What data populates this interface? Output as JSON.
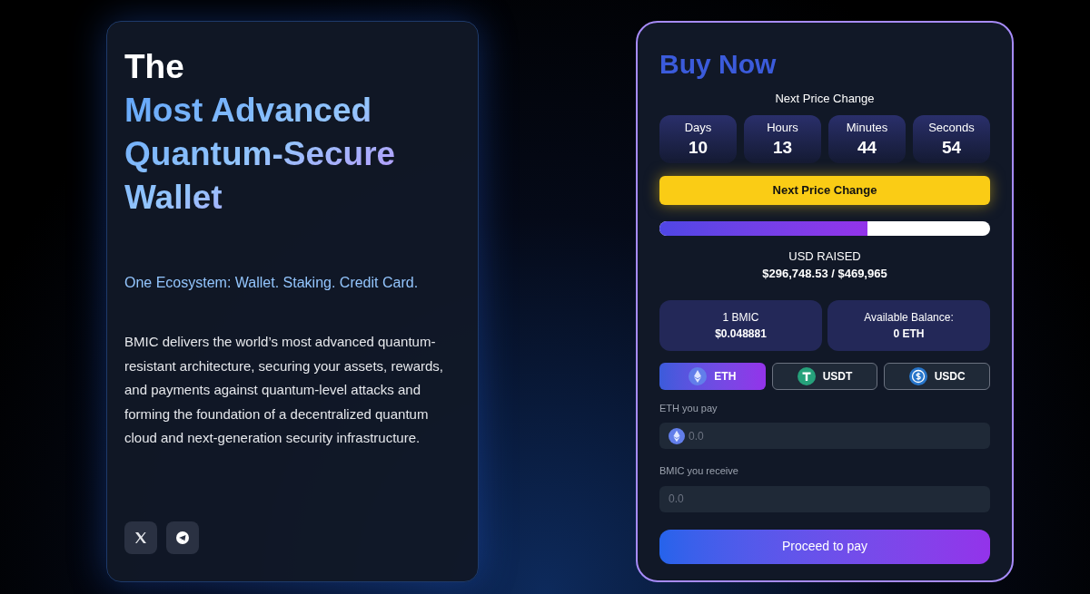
{
  "hero": {
    "title_lines": [
      {
        "text": "The",
        "kind": "plain"
      },
      {
        "text": "Most Advanced",
        "kind": "gradient"
      },
      {
        "text": "Quantum-Secure",
        "kind": "gradient"
      },
      {
        "text": "Wallet",
        "kind": "gradient"
      }
    ],
    "tagline": "One Ecosystem: Wallet. Staking. Credit Card.",
    "description": "BMIC delivers the world’s most advanced quantum-resistant architecture, securing your assets, rewards, and payments against quantum-level attacks and forming the foundation of a decentralized quantum cloud and next-generation security infrastructure.",
    "socials": [
      {
        "kind": "x"
      },
      {
        "kind": "telegram"
      }
    ]
  },
  "buy": {
    "title": "Buy Now",
    "countdown_label": "Next Price Change",
    "countdown": [
      {
        "label": "Days",
        "value": "10"
      },
      {
        "label": "Hours",
        "value": "13"
      },
      {
        "label": "Minutes",
        "value": "44"
      },
      {
        "label": "Seconds",
        "value": "54"
      }
    ],
    "price_button": "Next Price Change",
    "progress": {
      "level": 0.63
    },
    "raised_label": "USD RAISED",
    "raised_value": "$296,748.53 / $469,965",
    "stats": [
      {
        "label": "1 BMIC",
        "value": "$0.048881"
      },
      {
        "label": "Available Balance:",
        "value": "0 ETH"
      }
    ],
    "tokens": [
      {
        "label": "ETH",
        "kind": "eth",
        "selected": true
      },
      {
        "label": "USDT",
        "kind": "usdt",
        "selected": false
      },
      {
        "label": "USDC",
        "kind": "usdc",
        "selected": false
      }
    ],
    "fields": [
      {
        "label": "ETH you pay",
        "placeholder": "0.0",
        "kind": "eth"
      },
      {
        "label": "BMIC you receive",
        "placeholder": "0.0",
        "kind": "plain"
      }
    ],
    "submit": "Proceed to pay"
  }
}
